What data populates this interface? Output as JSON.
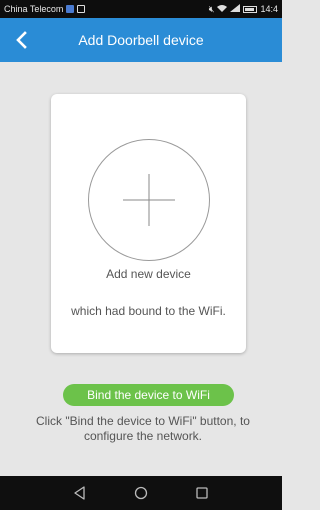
{
  "status_bar": {
    "carrier": "China Telecom",
    "time": "14:4",
    "icons": [
      "sim-icon",
      "image-notification-icon",
      "mute-icon",
      "wifi-icon",
      "signal-icon",
      "battery-icon"
    ]
  },
  "header": {
    "title": "Add Doorbell device",
    "background_color": "#2a8cd6",
    "back_icon": "chevron-left-icon"
  },
  "card": {
    "add_icon": "plus-icon",
    "add_label": "Add new device",
    "note": "which had bound to the WiFi."
  },
  "bind_button": {
    "label": "Bind the device to WiFi",
    "color": "#6cc24a"
  },
  "hint": "Click \"Bind the device to WiFi\" button, to configure the network.",
  "nav_bar": {
    "icons": [
      "back-triangle-icon",
      "home-circle-icon",
      "recents-square-icon"
    ]
  }
}
